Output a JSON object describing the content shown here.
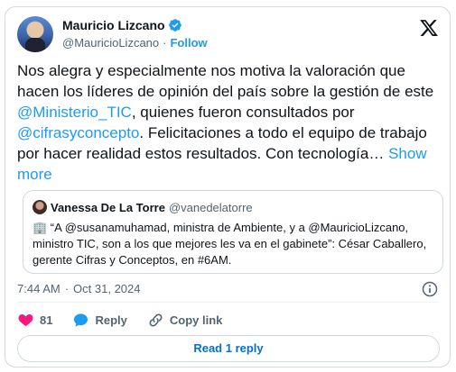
{
  "author": {
    "name": "Mauricio Lizcano",
    "handle": "@MauricioLizcano",
    "separator": "·",
    "follow_label": "Follow"
  },
  "tweet": {
    "text_1": "Nos alegra y especialmente nos motiva la valoración que hacen los líderes de opinión del país sobre la gestión de este ",
    "mention_1": "@Ministerio_TIC",
    "text_2": ", quienes fueron consultados por ",
    "mention_2": "@cifrasyconcepto",
    "text_3": ". Felicitaciones a todo el equipo de trabajo por hacer realidad estos resultados. Con tecnología… ",
    "show_more": "Show more"
  },
  "quote": {
    "name": "Vanessa De La Torre",
    "handle": "@vanedelatorre",
    "text": "🏢 “A @susanamuhamad, ministra de Ambiente, y a @MauricioLizcano, ministro TIC, son a los que mejores les va en el gabinete”: César Caballero, gerente Cifras y Conceptos, en #6AM."
  },
  "meta": {
    "time": "7:44 AM",
    "separator": "·",
    "date": "Oct 31, 2024"
  },
  "actions": {
    "likes": "81",
    "reply_label": "Reply",
    "copy_label": "Copy link"
  },
  "read_replies_label": "Read 1 reply",
  "colors": {
    "accent": "#1d9bf0",
    "like": "#f91880",
    "text": "#0f1419",
    "muted": "#536471",
    "border": "#cfd9de"
  },
  "icons": [
    "verified-badge-icon",
    "x-logo-icon",
    "info-icon",
    "heart-icon",
    "reply-bubble-icon",
    "link-icon"
  ]
}
